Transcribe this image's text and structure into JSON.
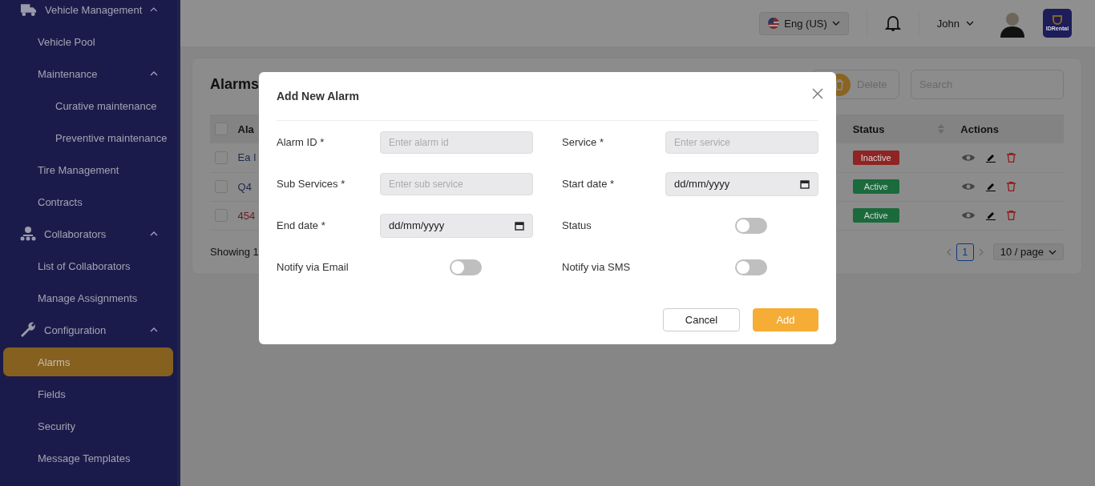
{
  "sidebar": {
    "items": [
      {
        "label": "Vehicle Management",
        "expanded": true,
        "children": [
          {
            "label": "Vehicle Pool",
            "selected": false
          },
          {
            "label": "Maintenance",
            "expanded": true,
            "children": [
              {
                "label": "Curative maintenance",
                "selected": false
              },
              {
                "label": "Preventive maintenance",
                "selected": false
              }
            ]
          },
          {
            "label": "Tire Management",
            "selected": false
          },
          {
            "label": "Contracts",
            "selected": false
          }
        ]
      },
      {
        "label": "Collaborators",
        "expanded": true,
        "children": [
          {
            "label": "List of Collaborators",
            "selected": false
          },
          {
            "label": "Manage Assignments",
            "selected": false
          }
        ]
      },
      {
        "label": "Configuration",
        "expanded": true,
        "children": [
          {
            "label": "Alarms",
            "selected": true
          },
          {
            "label": "Fields",
            "selected": false
          },
          {
            "label": "Security",
            "selected": false
          },
          {
            "label": "Message Templates",
            "selected": false
          }
        ]
      }
    ]
  },
  "header": {
    "language": "Eng (US)",
    "user": "John",
    "logo": "IDRental"
  },
  "page": {
    "title": "Alarms",
    "delete_button": "Delete",
    "search": {
      "placeholder": "Search"
    },
    "table": {
      "select_all": {
        "checked": false
      },
      "columns": [
        {
          "label": "Ala"
        },
        {
          "label": "Status",
          "sortable": true
        },
        {
          "label": "Actions",
          "sortable": false
        }
      ],
      "rows": [
        {
          "column_1": "Ea I",
          "color": "#1e2a4a",
          "status": "Inactive",
          "active": false,
          "checked": false
        },
        {
          "column_1": "Q4",
          "color": "#1e2a4a",
          "status": "Active",
          "active": true,
          "checked": false
        },
        {
          "column_1": "454",
          "color": "#6e1a1a",
          "status": "Active",
          "active": true,
          "checked": false
        }
      ]
    },
    "showing": "Showing 1",
    "pagination": {
      "pages": [
        {
          "label": "1",
          "selected": true
        }
      ],
      "page_size": "10 / page"
    }
  },
  "modal": {
    "title": "Add New Alarm",
    "fields": [
      {
        "kind": "text",
        "label": "Alarm ID *",
        "placeholder": "Enter alarm id"
      },
      {
        "kind": "text",
        "label": "Service *",
        "placeholder": "Enter service"
      },
      {
        "kind": "text",
        "label": "Sub Services *",
        "placeholder": "Enter sub service"
      },
      {
        "kind": "date",
        "label": "Start date *",
        "placeholder": "dd/mm/yyyy"
      },
      {
        "kind": "date",
        "label": "End date *",
        "placeholder": "dd/mm/yyyy"
      },
      {
        "kind": "toggle",
        "label": "Status",
        "on": false
      },
      {
        "kind": "toggle",
        "label": "Notify via Email",
        "on": false
      },
      {
        "kind": "toggle",
        "label": "Notify via SMS",
        "on": false
      }
    ],
    "buttons": [
      {
        "kind": "secondary",
        "label": "Cancel"
      },
      {
        "kind": "primary",
        "label": "Add"
      }
    ]
  }
}
